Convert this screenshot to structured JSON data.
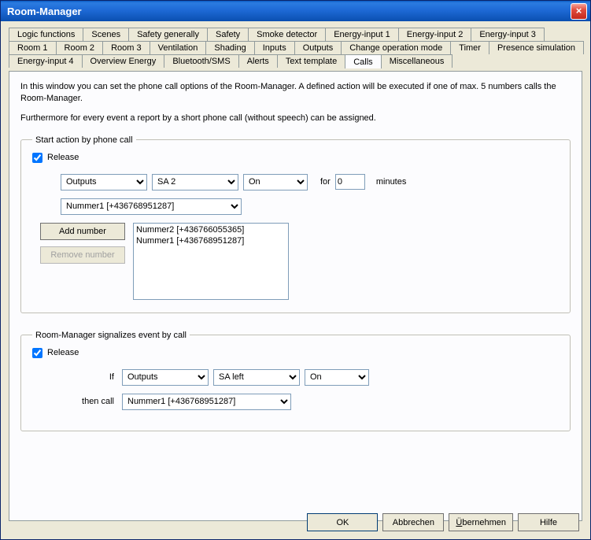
{
  "window": {
    "title": "Room-Manager"
  },
  "tabs": {
    "row1": [
      "Logic functions",
      "Scenes",
      "Safety generally",
      "Safety",
      "Smoke detector",
      "Energy-input 1",
      "Energy-input 2",
      "Energy-input 3"
    ],
    "row2": [
      "Room 1",
      "Room 2",
      "Room 3",
      "Ventilation",
      "Shading",
      "Inputs",
      "Outputs",
      "Change operation mode",
      "Timer",
      "Presence simulation"
    ],
    "row3": [
      "Energy-input 4",
      "Overview Energy",
      "Bluetooth/SMS",
      "Alerts",
      "Text template",
      "Calls",
      "Miscellaneous"
    ],
    "active": "Calls"
  },
  "description": {
    "p1": "In this window you can set the phone call options of the Room-Manager. A defined action will be executed if one of max. 5 numbers calls the Room-Manager.",
    "p2": "Furthermore for every event a report by a short phone call (without speech) can be assigned."
  },
  "group1": {
    "legend": "Start action by phone call",
    "release_label": "Release",
    "release_checked": true,
    "sel1": "Outputs",
    "sel2": "SA 2",
    "sel3": "On",
    "for_label": "for",
    "minutes_value": "0",
    "minutes_label": "minutes",
    "number_select": "Nummer1 [+436768951287]",
    "add_number_label": "Add number",
    "remove_number_label": "Remove number",
    "list": [
      "Nummer2 [+436766055365]",
      "Nummer1 [+436768951287]"
    ]
  },
  "group2": {
    "legend": "Room-Manager signalizes event by call",
    "release_label": "Release",
    "release_checked": true,
    "if_label": "If",
    "sel1": "Outputs",
    "sel2": "SA left",
    "sel3": "On",
    "then_call_label": "then call",
    "number_select": "Nummer1 [+436768951287]"
  },
  "buttons": {
    "ok": "OK",
    "cancel": "Abbrechen",
    "apply": "Übernehmen",
    "help": "Hilfe"
  }
}
